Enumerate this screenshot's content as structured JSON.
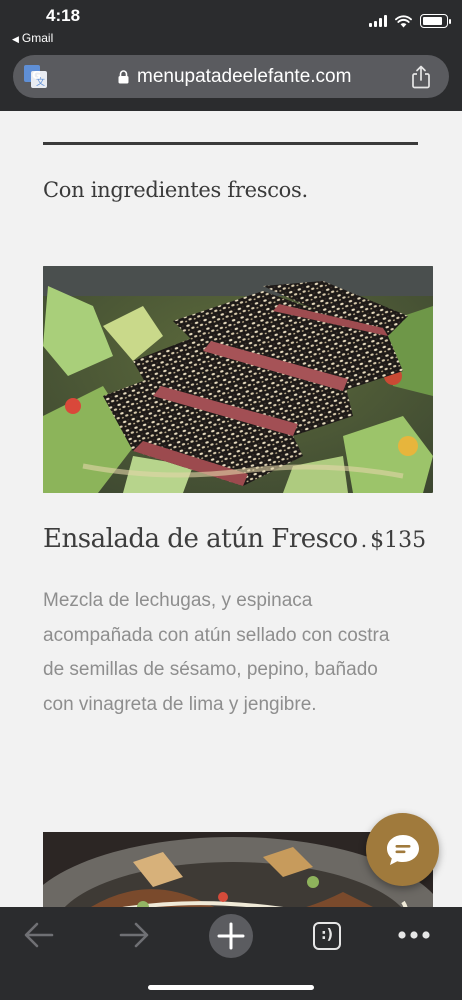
{
  "status_bar": {
    "time": "4:18",
    "back_app": "Gmail"
  },
  "browser": {
    "url": "menupatadeelefante.com",
    "icons": [
      "translate-icon",
      "lock-icon",
      "share-icon"
    ]
  },
  "content": {
    "intro": "Con ingredientes frescos.",
    "dish": {
      "name": "Ensalada de atún Fresco",
      "separator": ".",
      "price": "$135",
      "description": "Mezcla de lechugas, y espinaca acompañada con atún sellado con costra de semillas de sésamo, pepino, bañado con vinagreta de lima y jengibre."
    }
  },
  "toolbar": {
    "icons": [
      "back-arrow-icon",
      "forward-arrow-icon",
      "new-tab-icon",
      "tabs-icon",
      "more-icon"
    ],
    "tabs_label": ":)"
  },
  "colors": {
    "chrome": "#2b2c2e",
    "page_bg": "#f2f2f2",
    "accent_fab": "#a07a3c",
    "title_text": "#3d3d3d",
    "desc_text": "#8e8e8e"
  }
}
